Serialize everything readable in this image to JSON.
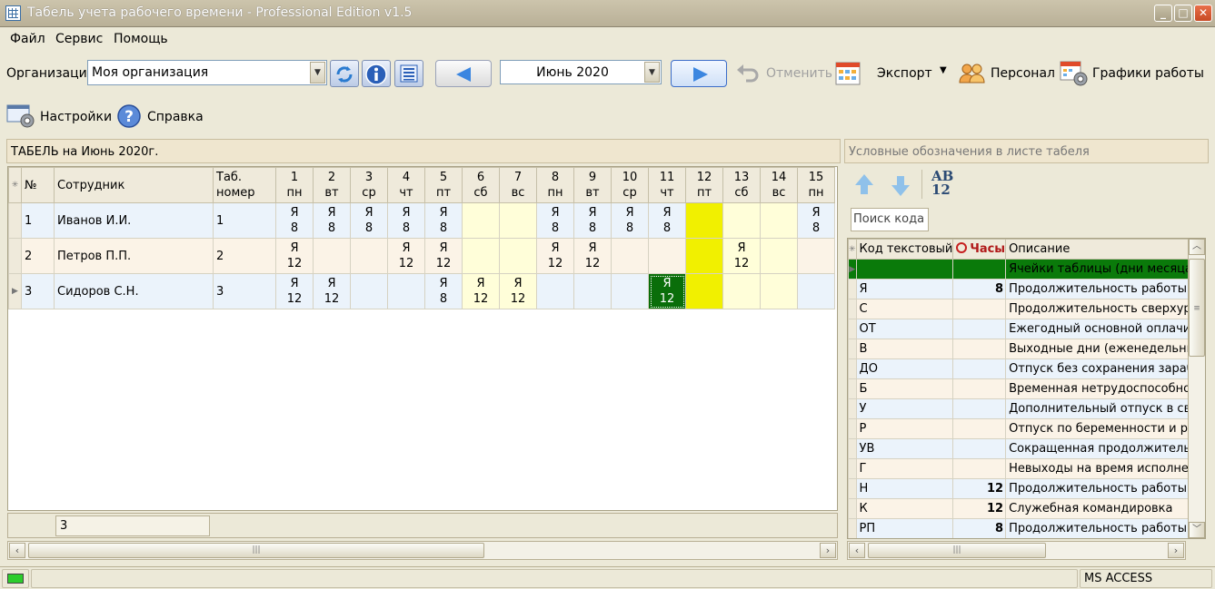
{
  "window": {
    "title": "Табель учета рабочего времени - Professional Edition v1.5"
  },
  "menu": {
    "file": "Файл",
    "service": "Сервис",
    "help": "Помощь"
  },
  "toolbar": {
    "org_label": "Организация",
    "org_value": "Моя организация",
    "month_value": "Июнь 2020",
    "undo_label": "Отменить",
    "export_label": "Экспорт",
    "personnel_label": "Персонал",
    "schedules_label": "Графики работы",
    "settings_label": "Настройки",
    "help_label": "Справка"
  },
  "timesheet": {
    "title": "ТАБЕЛЬ на Июнь 2020г.",
    "columns": {
      "num": "№",
      "employee": "Сотрудник",
      "tab1": "Таб.",
      "tab2": "номер"
    },
    "days": [
      {
        "d": "1",
        "w": "пн"
      },
      {
        "d": "2",
        "w": "вт"
      },
      {
        "d": "3",
        "w": "ср"
      },
      {
        "d": "4",
        "w": "чт"
      },
      {
        "d": "5",
        "w": "пт"
      },
      {
        "d": "6",
        "w": "сб"
      },
      {
        "d": "7",
        "w": "вс"
      },
      {
        "d": "8",
        "w": "пн"
      },
      {
        "d": "9",
        "w": "вт"
      },
      {
        "d": "10",
        "w": "ср"
      },
      {
        "d": "11",
        "w": "чт"
      },
      {
        "d": "12",
        "w": "пт"
      },
      {
        "d": "13",
        "w": "сб"
      },
      {
        "d": "14",
        "w": "вс"
      },
      {
        "d": "15",
        "w": "пн"
      }
    ],
    "rows": [
      {
        "num": "1",
        "name": "Иванов И.И.",
        "tab": "1",
        "cells": [
          [
            "Я",
            "8"
          ],
          [
            "Я",
            "8"
          ],
          [
            "Я",
            "8"
          ],
          [
            "Я",
            "8"
          ],
          [
            "Я",
            "8"
          ],
          [
            "",
            ""
          ],
          [
            "",
            ""
          ],
          [
            "Я",
            "8"
          ],
          [
            "Я",
            "8"
          ],
          [
            "Я",
            "8"
          ],
          [
            "Я",
            "8"
          ],
          [
            "",
            ""
          ],
          [
            "",
            ""
          ],
          [
            "",
            ""
          ],
          [
            "Я",
            "8"
          ]
        ]
      },
      {
        "num": "2",
        "name": "Петров П.П.",
        "tab": "2",
        "cells": [
          [
            "Я",
            "12"
          ],
          [
            "",
            ""
          ],
          [
            "",
            ""
          ],
          [
            "Я",
            "12"
          ],
          [
            "Я",
            "12"
          ],
          [
            "",
            ""
          ],
          [
            "",
            ""
          ],
          [
            "Я",
            "12"
          ],
          [
            "Я",
            "12"
          ],
          [
            "",
            ""
          ],
          [
            "",
            ""
          ],
          [
            "",
            ""
          ],
          [
            "Я",
            "12"
          ],
          [
            "",
            ""
          ],
          [
            "",
            ""
          ]
        ]
      },
      {
        "num": "3",
        "name": "Сидоров С.Н.",
        "tab": "3",
        "cells": [
          [
            "Я",
            "12"
          ],
          [
            "Я",
            "12"
          ],
          [
            "",
            ""
          ],
          [
            "",
            ""
          ],
          [
            "Я",
            "8"
          ],
          [
            "Я",
            "12"
          ],
          [
            "Я",
            "12"
          ],
          [
            "",
            ""
          ],
          [
            "",
            ""
          ],
          [
            "",
            ""
          ],
          [
            "Я",
            "12"
          ],
          [
            "",
            ""
          ],
          [
            "",
            ""
          ],
          [
            "",
            ""
          ],
          [
            "",
            ""
          ]
        ]
      }
    ],
    "footer_count": "3"
  },
  "legend": {
    "title": "Условные обозначения в листе табеля",
    "ab": "AB",
    "n12": "12",
    "search_placeholder": "Поиск кода",
    "columns": {
      "code": "Код текстовый",
      "hours": "Часы",
      "desc": "Описание"
    },
    "rows": [
      {
        "code": "",
        "hours": "",
        "desc": "Ячейки таблицы (дни месяца)"
      },
      {
        "code": "Я",
        "hours": "8",
        "desc": "Продолжительность работы"
      },
      {
        "code": "С",
        "hours": "",
        "desc": "Продолжительность сверхурочной работы"
      },
      {
        "code": "ОТ",
        "hours": "",
        "desc": "Ежегодный основной оплачиваемый отпуск"
      },
      {
        "code": "В",
        "hours": "",
        "desc": "Выходные дни (еженедельный отпуск)"
      },
      {
        "code": "ДО",
        "hours": "",
        "desc": "Отпуск без сохранения заработной платы"
      },
      {
        "code": "Б",
        "hours": "",
        "desc": "Временная нетрудоспособность"
      },
      {
        "code": "У",
        "hours": "",
        "desc": "Дополнительный отпуск в связи с обучением"
      },
      {
        "code": "Р",
        "hours": "",
        "desc": "Отпуск по беременности и родам"
      },
      {
        "code": "УВ",
        "hours": "",
        "desc": "Сокращенная продолжительность рабочего времени"
      },
      {
        "code": "Г",
        "hours": "",
        "desc": "Невыходы на время исполнения обязанностей"
      },
      {
        "code": "Н",
        "hours": "12",
        "desc": "Продолжительность работы в ночное время"
      },
      {
        "code": "К",
        "hours": "12",
        "desc": "Служебная командировка"
      },
      {
        "code": "РП",
        "hours": "8",
        "desc": "Продолжительность работы"
      }
    ]
  },
  "statusbar": {
    "db": "MS ACCESS"
  },
  "colors": {
    "weekend": "#fffed9",
    "holiday": "#f1f000",
    "selected": "#0a6e0a"
  }
}
